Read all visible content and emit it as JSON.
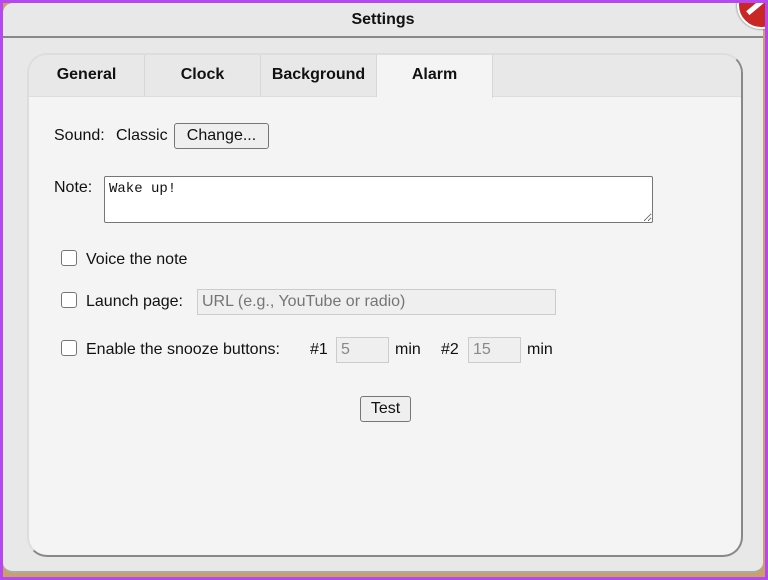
{
  "window": {
    "title": "Settings"
  },
  "tabs": [
    {
      "label": "General"
    },
    {
      "label": "Clock"
    },
    {
      "label": "Background"
    },
    {
      "label": "Alarm"
    }
  ],
  "alarm": {
    "sound_label": "Sound:",
    "sound_value": "Classic",
    "change_button": "Change...",
    "note_label": "Note:",
    "note_value": "Wake up!",
    "voice_label": "Voice the note",
    "launch_label": "Launch page:",
    "launch_placeholder": "URL (e.g., YouTube or radio)",
    "snooze_label": "Enable the snooze buttons:",
    "snooze1_label": "#1",
    "snooze1_value": "5",
    "snooze2_label": "#2",
    "snooze2_value": "15",
    "min_label": "min",
    "test_button": "Test"
  }
}
